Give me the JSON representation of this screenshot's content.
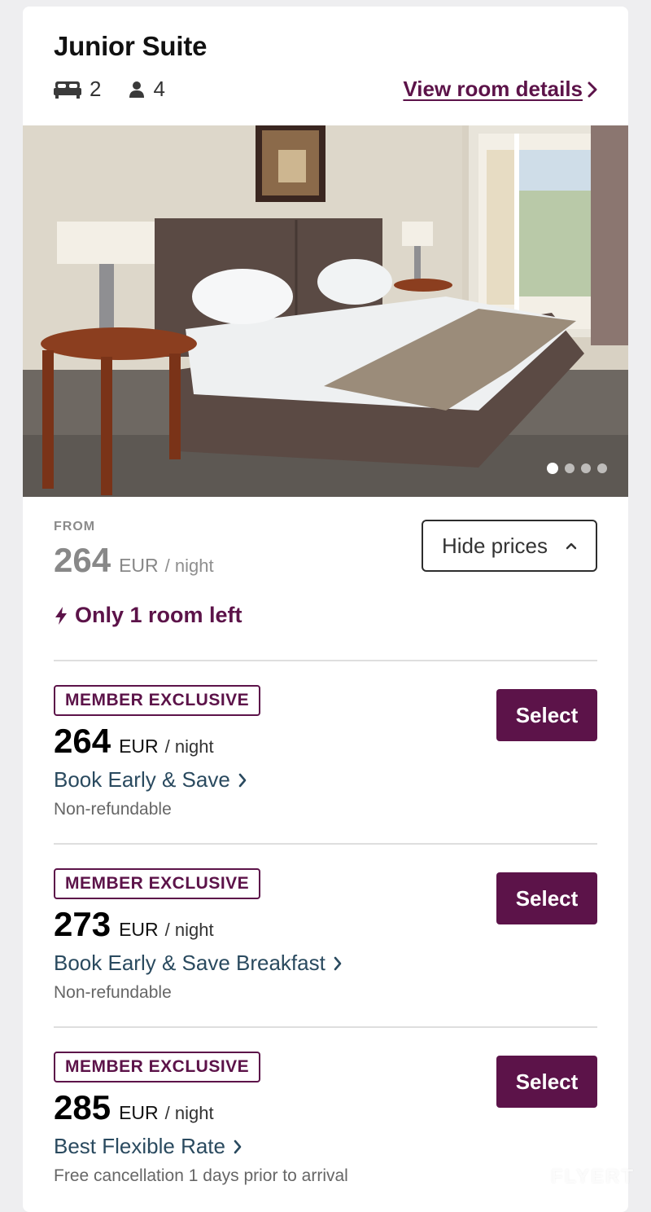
{
  "room": {
    "title": "Junior Suite",
    "beds": "2",
    "guests": "4",
    "details_link": "View room details",
    "bed_icon": "bed-icon",
    "guest_icon": "person-icon"
  },
  "gallery": {
    "total_images": 4,
    "active_index": 0
  },
  "summary": {
    "from_label": "FROM",
    "price": "264",
    "currency": "EUR",
    "per_night": "/ night",
    "hide_prices": "Hide prices",
    "scarcity": "Only 1 room left"
  },
  "rates": [
    {
      "badge": "MEMBER EXCLUSIVE",
      "price": "264",
      "currency": "EUR",
      "per_night": "/ night",
      "name": "Book Early & Save",
      "policy": "Non-refundable",
      "select": "Select"
    },
    {
      "badge": "MEMBER EXCLUSIVE",
      "price": "273",
      "currency": "EUR",
      "per_night": "/ night",
      "name": "Book Early & Save Breakfast",
      "policy": "Non-refundable",
      "select": "Select"
    },
    {
      "badge": "MEMBER EXCLUSIVE",
      "price": "285",
      "currency": "EUR",
      "per_night": "/ night",
      "name": "Best Flexible Rate",
      "policy": "Free cancellation 1 days prior to arrival",
      "select": "Select"
    }
  ],
  "watermark": "FLYERT",
  "colors": {
    "brand": "#5c1349",
    "link_blue": "#2a4a5f",
    "muted": "#888888",
    "page_bg": "#eeeef0"
  }
}
